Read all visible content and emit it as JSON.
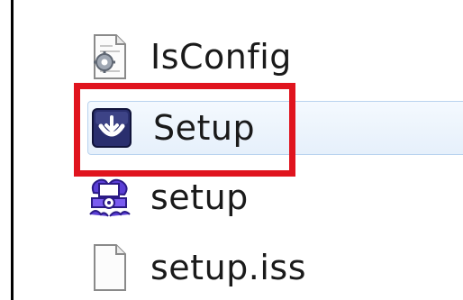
{
  "files": [
    {
      "name": "IsConfig",
      "icon": "config-file-icon"
    },
    {
      "name": "Setup",
      "icon": "setup-application-icon",
      "state": "hovered"
    },
    {
      "name": "setup",
      "icon": "installer-icon"
    },
    {
      "name": "setup.iss",
      "icon": "blank-file-icon"
    }
  ],
  "annotation": {
    "color": "#e0141e",
    "target": "Setup"
  }
}
